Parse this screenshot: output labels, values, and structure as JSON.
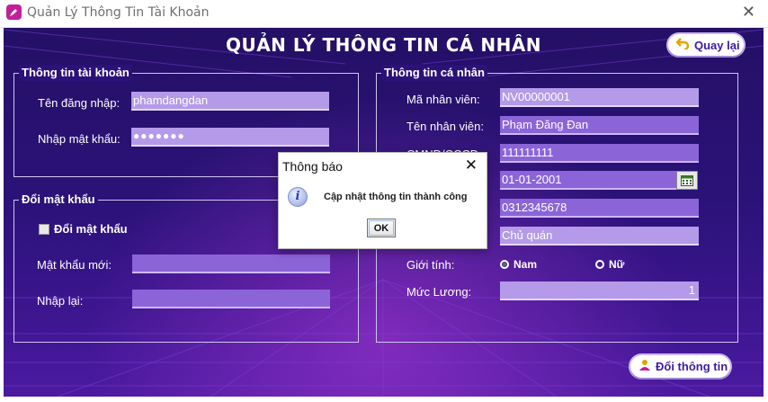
{
  "window": {
    "title": "Quản Lý Thông Tin Tài Khoản",
    "close_icon": "close-icon",
    "app_icon": "pen-icon"
  },
  "page": {
    "title": "QUẢN LÝ THÔNG TIN CÁ NHÂN"
  },
  "buttons": {
    "back_label": "Quay lại",
    "back_icon": "return-arrow-icon",
    "update_label": "Đổi thông tin",
    "update_icon": "user-edit-icon"
  },
  "account": {
    "title": "Thông tin tài khoản",
    "username_label": "Tên đăng nhập:",
    "username_value": "phamdangdan",
    "password_label": "Nhập mật khẩu:",
    "password_value": "●●●●●●●"
  },
  "change_password": {
    "title": "Đổi mật khẩu",
    "checkbox_label": "Đổi mật khẩu",
    "checked": false,
    "new_password_label": "Mật khẩu mới:",
    "new_password_value": "",
    "confirm_label": "Nhập lại:",
    "confirm_value": ""
  },
  "personal": {
    "title": "Thông tin cá nhân",
    "employee_id_label": "Mã nhân viên:",
    "employee_id_value": "NV00000001",
    "employee_name_label": "Tên nhân viên:",
    "employee_name_value": "Phạm Đăng Đan",
    "id_card_label": "CMND/CCCD:",
    "id_card_value": "111111111",
    "dob_value": "01-01-2001",
    "phone_value": "0312345678",
    "role_value": "Chủ quán",
    "gender_label": "Giới tính:",
    "gender_options": [
      "Nam",
      "Nữ"
    ],
    "gender_selected": "Nam",
    "salary_label": "Mức Lương:",
    "salary_value": "1"
  },
  "dialog": {
    "title": "Thông báo",
    "message": "Cập nhật thông tin thành công",
    "ok_label": "OK",
    "icon": "info-icon"
  },
  "colors": {
    "background": "#2a1277",
    "field": "#b49ae8",
    "field_dark": "#8b65d8",
    "accent_text": "#3d1ba3"
  }
}
